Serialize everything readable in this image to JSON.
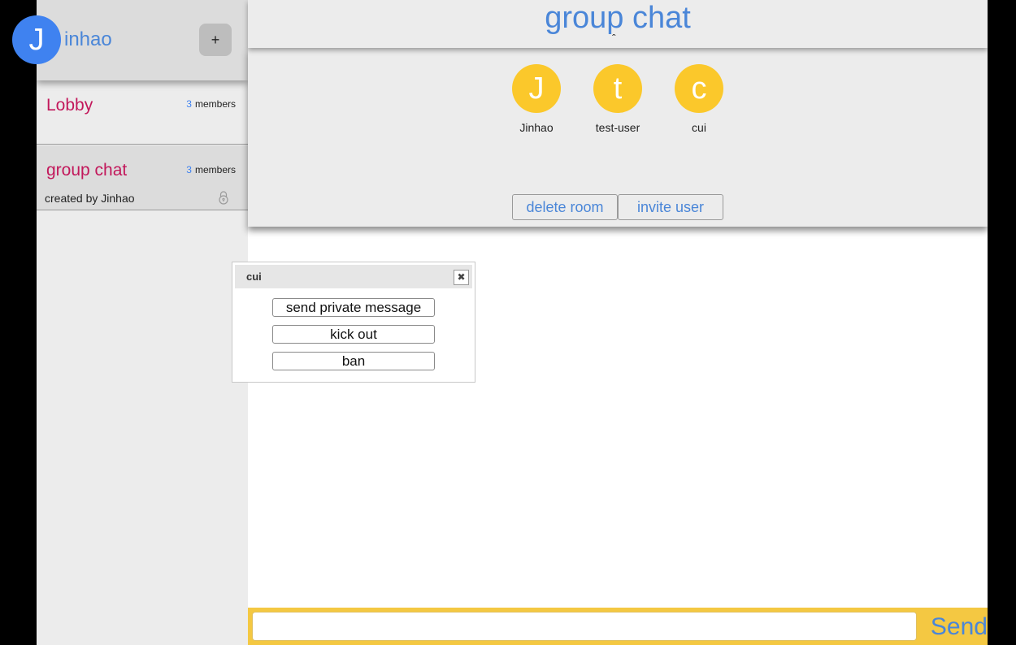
{
  "user": {
    "avatar_letter": "J",
    "name": "inhao"
  },
  "sidebar": {
    "add_label": "+",
    "rooms": [
      {
        "name": "Lobby",
        "member_count": "3",
        "members_label": "members"
      },
      {
        "name": "group chat",
        "member_count": "3",
        "members_label": "members",
        "creator": "created by Jinhao",
        "locked": true
      }
    ]
  },
  "room": {
    "title": "group chat",
    "collapse_glyph": "ˆ",
    "members": [
      {
        "letter": "J",
        "name": "Jinhao"
      },
      {
        "letter": "t",
        "name": "test-user"
      },
      {
        "letter": "c",
        "name": "cui"
      }
    ],
    "delete_label": "delete room",
    "invite_label": "invite user"
  },
  "popup": {
    "title": "cui",
    "close_glyph": "✖",
    "actions": [
      "send private message",
      "kick out",
      "ban"
    ]
  },
  "composer": {
    "value": "",
    "send_label": "Send"
  },
  "colors": {
    "accent_blue": "#4a86d8",
    "room_pink": "#c2185b",
    "avatar_yellow": "#fbc82b",
    "input_bar": "#f4c842"
  }
}
